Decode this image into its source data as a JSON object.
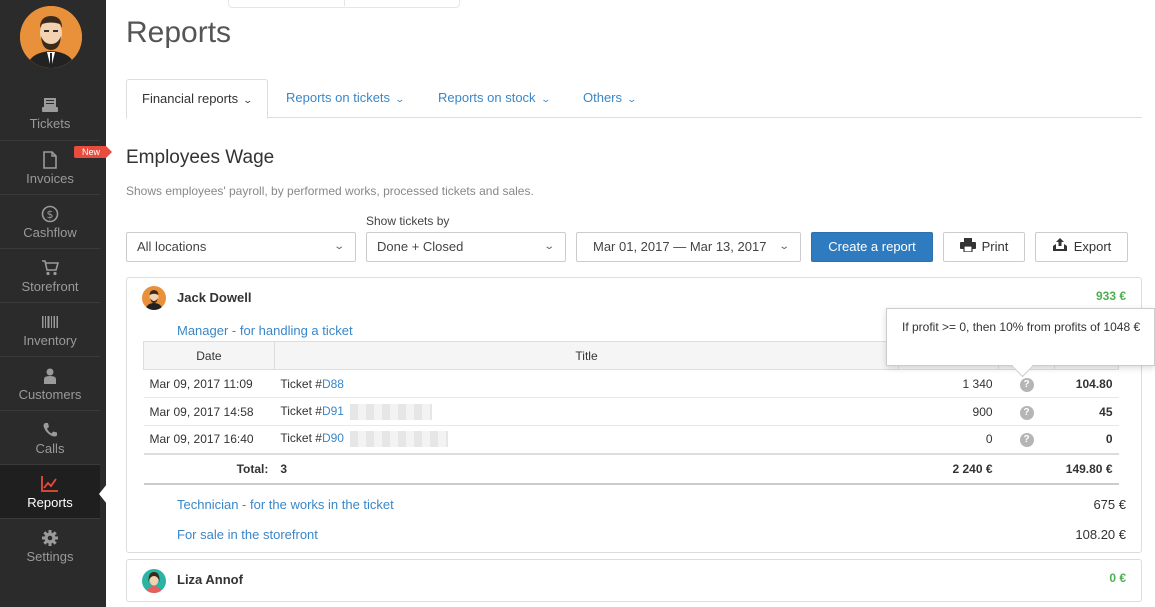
{
  "sidebar": {
    "items": [
      {
        "label": "Tickets",
        "icon": "ticket-icon"
      },
      {
        "label": "Invoices",
        "icon": "document-icon",
        "badge": "New"
      },
      {
        "label": "Cashflow",
        "icon": "dollar-icon"
      },
      {
        "label": "Storefront",
        "icon": "cart-icon"
      },
      {
        "label": "Inventory",
        "icon": "barcode-icon"
      },
      {
        "label": "Customers",
        "icon": "user-icon"
      },
      {
        "label": "Calls",
        "icon": "phone-icon"
      },
      {
        "label": "Reports",
        "icon": "chart-icon",
        "active": true
      },
      {
        "label": "Settings",
        "icon": "gear-icon"
      }
    ]
  },
  "page": {
    "title": "Reports"
  },
  "tabs": [
    {
      "label": "Financial reports",
      "active": true
    },
    {
      "label": "Reports on tickets"
    },
    {
      "label": "Reports on stock"
    },
    {
      "label": "Others"
    }
  ],
  "section": {
    "title": "Employees Wage",
    "description": "Shows employees' payroll, by performed works, processed tickets and sales."
  },
  "filters": {
    "location": "All locations",
    "show_by_label": "Show tickets by",
    "show_by": "Done + Closed",
    "date_range": "Mar 01, 2017 — Mar 13, 2017",
    "create_label": "Create a report",
    "print_label": "Print",
    "export_label": "Export"
  },
  "employees": [
    {
      "name": "Jack Dowell",
      "total": "933 €",
      "role_manager": "Manager - for handling a ticket",
      "table": {
        "headers": {
          "date": "Date",
          "title": "Title"
        },
        "rows": [
          {
            "date": "Mar 09, 2017 11:09",
            "prefix": "Ticket #",
            "ticket": "D88",
            "amount": "1 340",
            "q": "?",
            "profit": "104.80"
          },
          {
            "date": "Mar 09, 2017 14:58",
            "prefix": "Ticket #",
            "ticket": "D91",
            "amount": "900",
            "q": "?",
            "profit": "45"
          },
          {
            "date": "Mar 09, 2017 16:40",
            "prefix": "Ticket #",
            "ticket": "D90",
            "amount": "0",
            "q": "?",
            "profit": "0"
          }
        ],
        "total": {
          "label": "Total:",
          "count": "3",
          "amount": "2 240 €",
          "profit": "149.80 €"
        }
      },
      "role_technician": "Technician - for the works in the ticket",
      "technician_amount": "675 €",
      "role_sale": "For sale in the storefront",
      "sale_amount": "108.20 €"
    },
    {
      "name": "Liza Annof",
      "total": "0 €"
    }
  ],
  "tooltip": {
    "text": "If profit >= 0, then 10% from profits of 1048 €"
  },
  "colors": {
    "sidebar": "#2b2b2b",
    "accent": "#2f7bbf",
    "link": "#3a87c8",
    "positive": "#4caf50",
    "badge": "#e74c3c"
  }
}
